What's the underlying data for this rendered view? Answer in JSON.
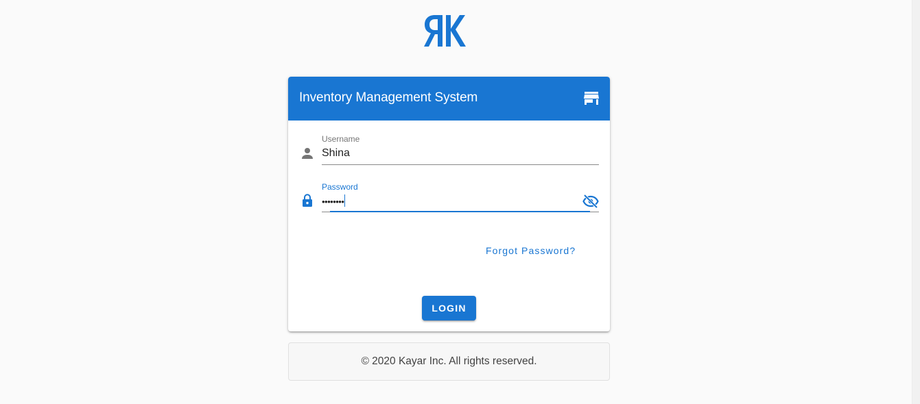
{
  "brand": {
    "logo_text": "RK",
    "color": "#1976d2"
  },
  "card": {
    "title": "Inventory Management System",
    "header_icon": "store-icon"
  },
  "username": {
    "label": "Username",
    "value": "Shina",
    "icon": "person-icon"
  },
  "password": {
    "label": "Password",
    "value": "••••••••",
    "icon": "lock-icon",
    "toggle_icon": "eye-off-icon"
  },
  "forgot_password_label": "Forgot Password?",
  "login_label": "LOGIN",
  "footer_text": "© 2020 Kayar Inc. All rights reserved."
}
